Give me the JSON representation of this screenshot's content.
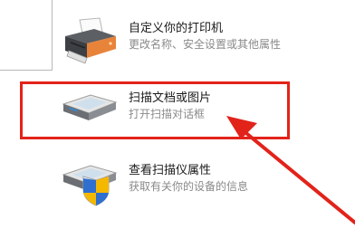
{
  "tasks": [
    {
      "title": "自定义你的打印机",
      "description": "更改名称、安全设置或其他属性",
      "icon": "printer-icon"
    },
    {
      "title": "扫描文档或图片",
      "description": "打开扫描对话框",
      "icon": "scanner-icon"
    },
    {
      "title": "查看扫描仪属性",
      "description": "获取有关你的设备的信息",
      "icon": "scanner-shield-icon"
    }
  ],
  "colors": {
    "highlight": "#e2231a",
    "printer_accent": "#e8833a",
    "title_text": "#1a1a1a",
    "description_text": "#8a8a8a"
  }
}
